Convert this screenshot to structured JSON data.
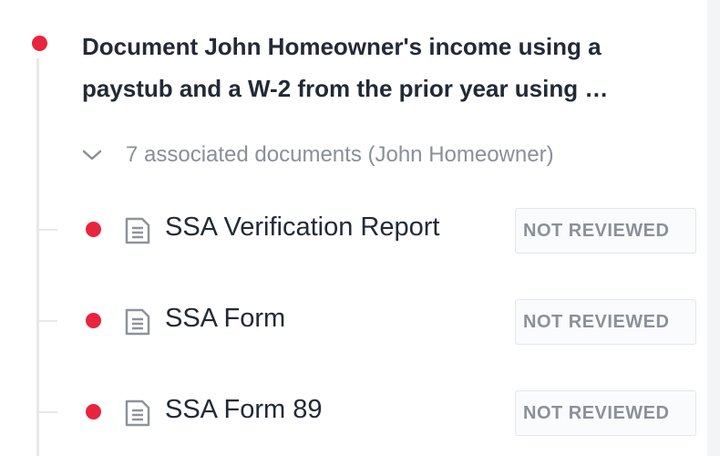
{
  "task": {
    "title_line1": "Document John Homeowner's income using a",
    "title_line2": "paystub and a W-2 from the prior year using …",
    "status_color": "#e8243f"
  },
  "associated": {
    "label": "7 associated documents (John Homeowner)",
    "expanded": true,
    "icon": "chevron-down-icon"
  },
  "documents": [
    {
      "name": "SSA Verification Report",
      "status": "NOT REVIEWED",
      "icon": "document-icon"
    },
    {
      "name": "SSA Form",
      "status": "NOT REVIEWED",
      "icon": "document-icon"
    },
    {
      "name": "SSA Form 89",
      "status": "NOT REVIEWED",
      "icon": "document-icon"
    }
  ]
}
